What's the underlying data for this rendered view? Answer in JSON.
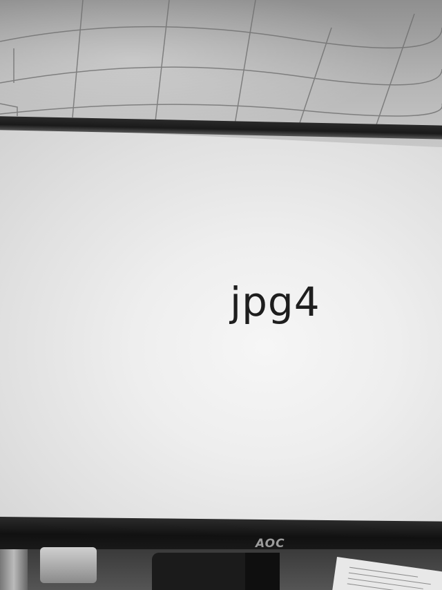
{
  "screen": {
    "text": "jpg4"
  },
  "monitor": {
    "brand": "AOC"
  },
  "colors": {
    "screen_background": "#ececec",
    "screen_text": "#1e1e1e",
    "bezel": "#151515",
    "ceiling": "#a8a8a8"
  }
}
